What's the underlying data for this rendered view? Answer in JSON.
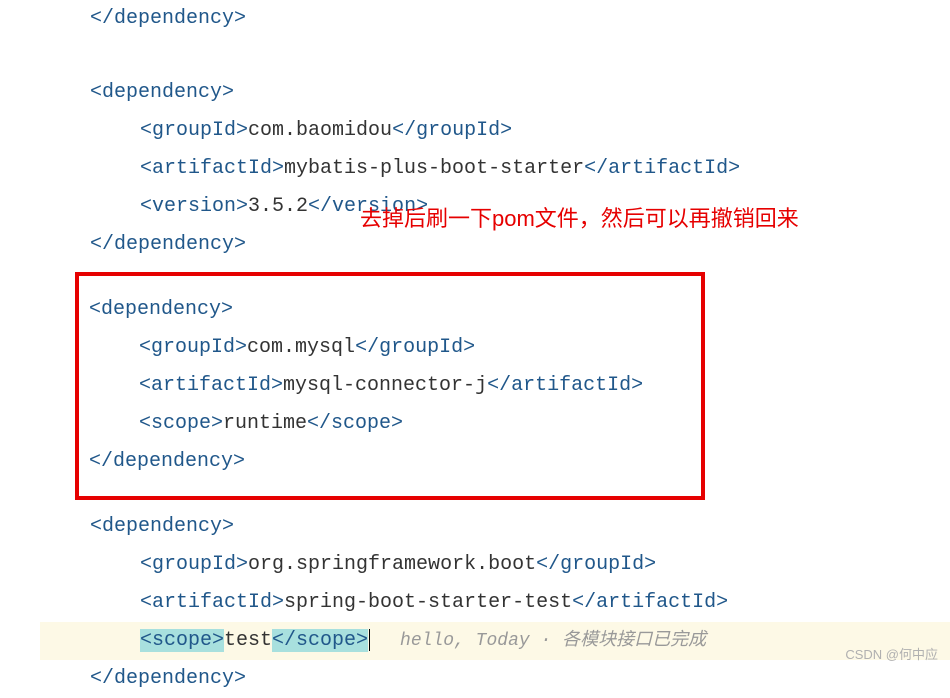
{
  "code": {
    "closeDep0": "</dependency>",
    "dep1": {
      "open": "<dependency>",
      "groupIdOpen": "<groupId>",
      "groupIdVal": "com.baomidou",
      "groupIdClose": "</groupId>",
      "artifactIdOpen": "<artifactId>",
      "artifactIdVal": "mybatis-plus-boot-starter",
      "artifactIdClose": "</artifactId>",
      "versionOpen": "<version>",
      "versionVal": "3.5.2",
      "versionClose": "</version>",
      "close": "</dependency>"
    },
    "dep2": {
      "open": "<dependency>",
      "groupIdOpen": "<groupId>",
      "groupIdVal": "com.mysql",
      "groupIdClose": "</groupId>",
      "artifactIdOpen": "<artifactId>",
      "artifactIdVal": "mysql-connector-j",
      "artifactIdClose": "</artifactId>",
      "scopeOpen": "<scope>",
      "scopeVal": "runtime",
      "scopeClose": "</scope>",
      "close": "</dependency>"
    },
    "dep3": {
      "open": "<dependency>",
      "groupIdOpen": "<groupId>",
      "groupIdVal": "org.springframework.boot",
      "groupIdClose": "</groupId>",
      "artifactIdOpen": "<artifactId>",
      "artifactIdVal": "spring-boot-starter-test",
      "artifactIdClose": "</artifactId>",
      "scopeOpen": "<scope>",
      "scopeVal": "test",
      "scopeClose": "</scope>",
      "close": "</dependency>"
    }
  },
  "annotation": "去掉后刷一下pom文件，然后可以再撤销回来",
  "inlineHint": {
    "text1": "hello, Today",
    "dot": " · ",
    "text2": "各模块接口已完成"
  },
  "watermark": "CSDN @何中应"
}
